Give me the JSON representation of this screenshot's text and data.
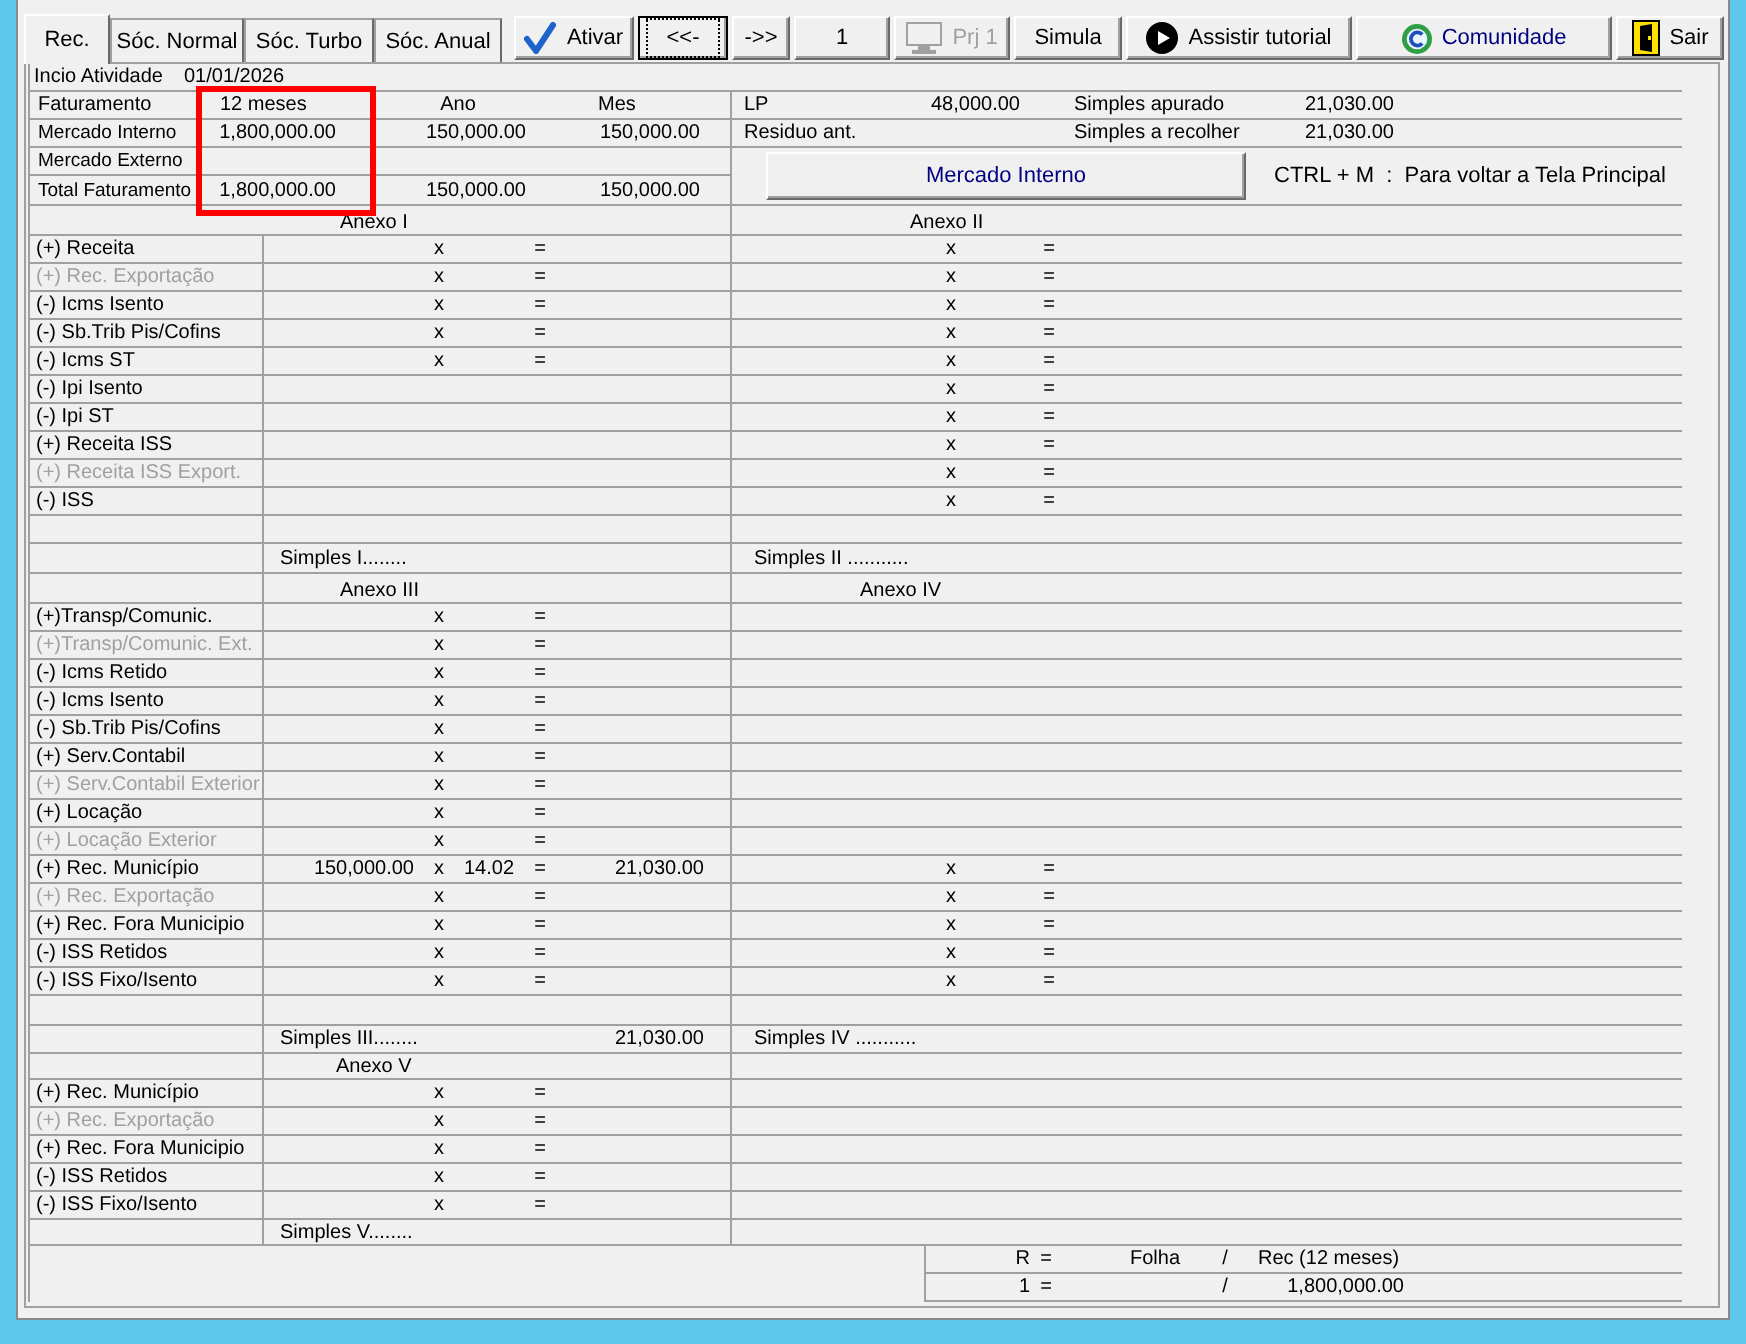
{
  "tabs": [
    {
      "label": "Rec.",
      "selected": true
    },
    {
      "label": "Sóc. Normal",
      "selected": false
    },
    {
      "label": "Sóc. Turbo",
      "selected": false
    },
    {
      "label": "Sóc. Anual",
      "selected": false
    }
  ],
  "toolbar": [
    {
      "label": "Ativar",
      "kind": "confirm",
      "disabled": false,
      "focused": false
    },
    {
      "label": "<<-",
      "kind": "text",
      "disabled": false,
      "focused": true
    },
    {
      "label": "->>",
      "kind": "text",
      "disabled": false,
      "focused": false
    },
    {
      "label": "1",
      "kind": "text",
      "disabled": false,
      "focused": false
    },
    {
      "label": "Prj 1",
      "kind": "project",
      "disabled": true,
      "focused": false
    },
    {
      "label": "Simula",
      "kind": "text",
      "disabled": false,
      "focused": false
    },
    {
      "label": "Assistir tutorial",
      "kind": "video",
      "disabled": false,
      "focused": false
    },
    {
      "label": "Comunidade",
      "kind": "community",
      "disabled": false,
      "focused": false
    },
    {
      "label": "Sair",
      "kind": "exit",
      "disabled": false,
      "focused": false
    }
  ],
  "start": {
    "label": "Incio Atividade",
    "date": "01/01/2026"
  },
  "billing": {
    "columns": [
      "Faturamento",
      "12 meses",
      "Ano",
      "Mes"
    ],
    "rows": [
      {
        "label": "Mercado Interno",
        "values": [
          "1,800,000.00",
          "150,000.00",
          "150,000.00"
        ]
      },
      {
        "label": "Mercado Externo"
      },
      {
        "label": "Total Faturamento",
        "values": [
          "1,800,000.00",
          "150,000.00",
          "150,000.00"
        ]
      }
    ]
  },
  "summary": [
    {
      "label": "LP",
      "value": "48,000.00",
      "label_2": "Simples apurado",
      "value_2": "21,030.00"
    },
    {
      "label": "Residuo ant.",
      "label_2": "Simples a recolher",
      "value_2": "21,030.00"
    }
  ],
  "market_button": {
    "label": "Mercado Interno"
  },
  "shortcut_hint": "CTRL + M  :  Para voltar a Tela Principal",
  "sections": [
    {
      "left_title": "Anexo I",
      "right_title": "Anexo II",
      "rows": [
        {
          "label": "(+) Receita",
          "disabled": false,
          "left": {
            "times": "x",
            "equals": "="
          },
          "right": {
            "times": "x",
            "equals": "="
          }
        },
        {
          "label": "(+) Rec. Exportação",
          "disabled": true,
          "left": {
            "times": "x",
            "equals": "="
          },
          "right": {
            "times": "x",
            "equals": "="
          }
        },
        {
          "label": "(-) Icms Isento",
          "disabled": false,
          "left": {
            "times": "x",
            "equals": "="
          },
          "right": {
            "times": "x",
            "equals": "="
          }
        },
        {
          "label": "(-) Sb.Trib Pis/Cofins",
          "disabled": false,
          "left": {
            "times": "x",
            "equals": "="
          },
          "right": {
            "times": "x",
            "equals": "="
          }
        },
        {
          "label": "(-) Icms ST",
          "disabled": false,
          "left": {
            "times": "x",
            "equals": "="
          },
          "right": {
            "times": "x",
            "equals": "="
          }
        },
        {
          "label": "(-) Ipi Isento",
          "disabled": false,
          "right": {
            "times": "x",
            "equals": "="
          }
        },
        {
          "label": "(-) Ipi ST",
          "disabled": false,
          "right": {
            "times": "x",
            "equals": "="
          }
        },
        {
          "label": "(+) Receita ISS",
          "disabled": false,
          "right": {
            "times": "x",
            "equals": "="
          }
        },
        {
          "label": "(+) Receita ISS Export.",
          "disabled": true,
          "right": {
            "times": "x",
            "equals": "="
          }
        },
        {
          "label": "(-) ISS",
          "disabled": false,
          "right": {
            "times": "x",
            "equals": "="
          }
        }
      ],
      "spacer_row": true,
      "left_total": {
        "label": "Simples I........"
      },
      "right_total": {
        "label": "Simples II ..........."
      }
    },
    {
      "left_title": "Anexo III",
      "right_title": "Anexo IV",
      "rows": [
        {
          "label": "(+)Transp/Comunic.",
          "disabled": false,
          "left": {
            "times": "x",
            "equals": "="
          }
        },
        {
          "label": "(+)Transp/Comunic. Ext.",
          "disabled": true,
          "left": {
            "times": "x",
            "equals": "="
          }
        },
        {
          "label": "(-) Icms Retido",
          "disabled": false,
          "left": {
            "times": "x",
            "equals": "="
          }
        },
        {
          "label": "(-) Icms Isento",
          "disabled": false,
          "left": {
            "times": "x",
            "equals": "="
          }
        },
        {
          "label": "(-) Sb.Trib Pis/Cofins",
          "disabled": false,
          "left": {
            "times": "x",
            "equals": "="
          }
        },
        {
          "label": "(+) Serv.Contabil",
          "disabled": false,
          "left": {
            "times": "x",
            "equals": "="
          }
        },
        {
          "label": "(+) Serv.Contabil Exterior",
          "disabled": true,
          "left": {
            "times": "x",
            "equals": "="
          }
        },
        {
          "label": "(+) Locação",
          "disabled": false,
          "left": {
            "times": "x",
            "equals": "="
          }
        },
        {
          "label": "(+) Locação Exterior",
          "disabled": true,
          "left": {
            "times": "x",
            "equals": "="
          }
        },
        {
          "label": "(+) Rec. Município",
          "disabled": false,
          "left": {
            "base": "150,000.00",
            "times": "x",
            "rate": "14.02",
            "equals": "=",
            "result": "21,030.00"
          },
          "right": {
            "times": "x",
            "equals": "="
          }
        },
        {
          "label": "(+) Rec. Exportação",
          "disabled": true,
          "left": {
            "times": "x",
            "equals": "="
          },
          "right": {
            "times": "x",
            "equals": "="
          }
        },
        {
          "label": "(+) Rec. Fora Municipio",
          "disabled": false,
          "left": {
            "times": "x",
            "equals": "="
          },
          "right": {
            "times": "x",
            "equals": "="
          }
        },
        {
          "label": "(-) ISS Retidos",
          "disabled": false,
          "left": {
            "times": "x",
            "equals": "="
          },
          "right": {
            "times": "x",
            "equals": "="
          }
        },
        {
          "label": "(-) ISS Fixo/Isento",
          "disabled": false,
          "left": {
            "times": "x",
            "equals": "="
          },
          "right": {
            "times": "x",
            "equals": "="
          }
        }
      ],
      "spacer_row": true,
      "left_total": {
        "label": "Simples III........",
        "value": "21,030.00"
      },
      "right_total": {
        "label": "Simples IV ..........."
      }
    },
    {
      "left_title": "Anexo V",
      "rows": [
        {
          "label": "(+) Rec. Município",
          "disabled": false,
          "left": {
            "times": "x",
            "equals": "="
          }
        },
        {
          "label": "(+) Rec. Exportação",
          "disabled": true,
          "left": {
            "times": "x",
            "equals": "="
          }
        },
        {
          "label": "(+) Rec. Fora Municipio",
          "disabled": false,
          "left": {
            "times": "x",
            "equals": "="
          }
        },
        {
          "label": "(-) ISS Retidos",
          "disabled": false,
          "left": {
            "times": "x",
            "equals": "="
          }
        },
        {
          "label": "(-) ISS Fixo/Isento",
          "disabled": false,
          "left": {
            "times": "x",
            "equals": "="
          }
        }
      ],
      "spacer_row": false,
      "left_total": {
        "label": "Simples V........"
      }
    }
  ],
  "ratio": {
    "header": {
      "r": "R",
      "equals": "=",
      "payroll": "Folha",
      "slash": "/",
      "revenue": "Rec (12 meses)"
    },
    "row": {
      "r": "1",
      "equals": "=",
      "slash": "/",
      "revenue": "1,800,000.00"
    }
  }
}
